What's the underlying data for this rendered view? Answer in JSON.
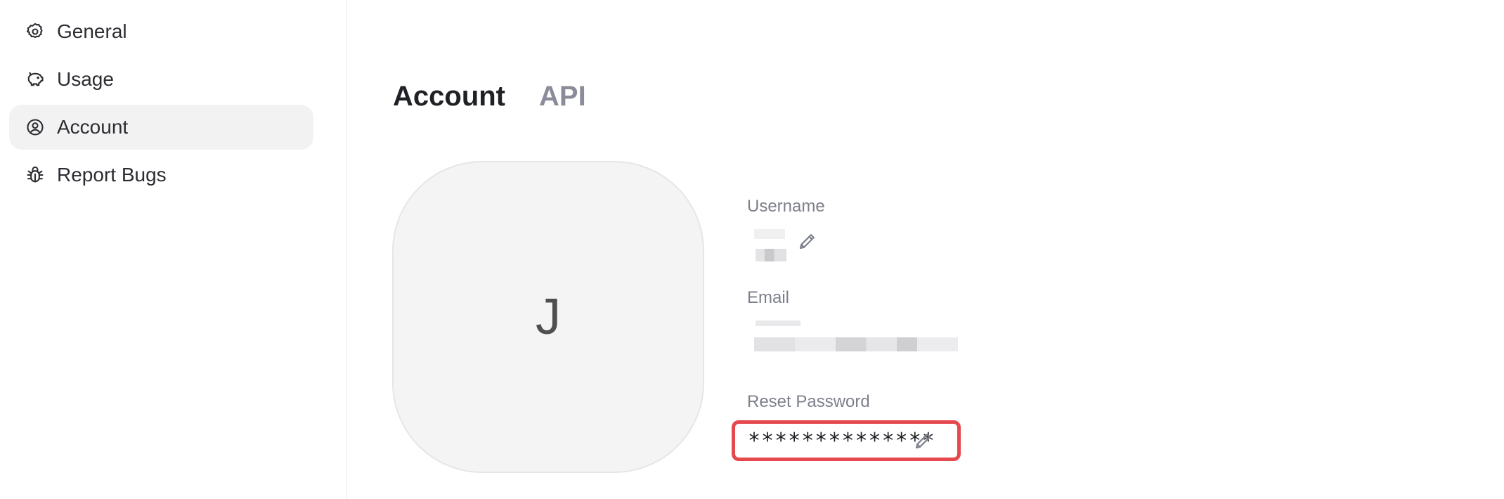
{
  "sidebar": {
    "items": [
      {
        "label": "General",
        "icon": "gear-icon",
        "active": false
      },
      {
        "label": "Usage",
        "icon": "piggy-bank-icon",
        "active": false
      },
      {
        "label": "Account",
        "icon": "user-circle-icon",
        "active": true
      },
      {
        "label": "Report Bugs",
        "icon": "bug-icon",
        "active": false
      }
    ]
  },
  "tabs": [
    {
      "label": "Account",
      "active": true
    },
    {
      "label": "API",
      "active": false
    }
  ],
  "profile": {
    "avatar_initial": "J",
    "username_label": "Username",
    "email_label": "Email",
    "password_label": "Reset Password",
    "password_value": "**************"
  },
  "colors": {
    "highlight": "#e5484d",
    "active_bg": "#f2f2f3",
    "muted_text": "#7d808a"
  }
}
